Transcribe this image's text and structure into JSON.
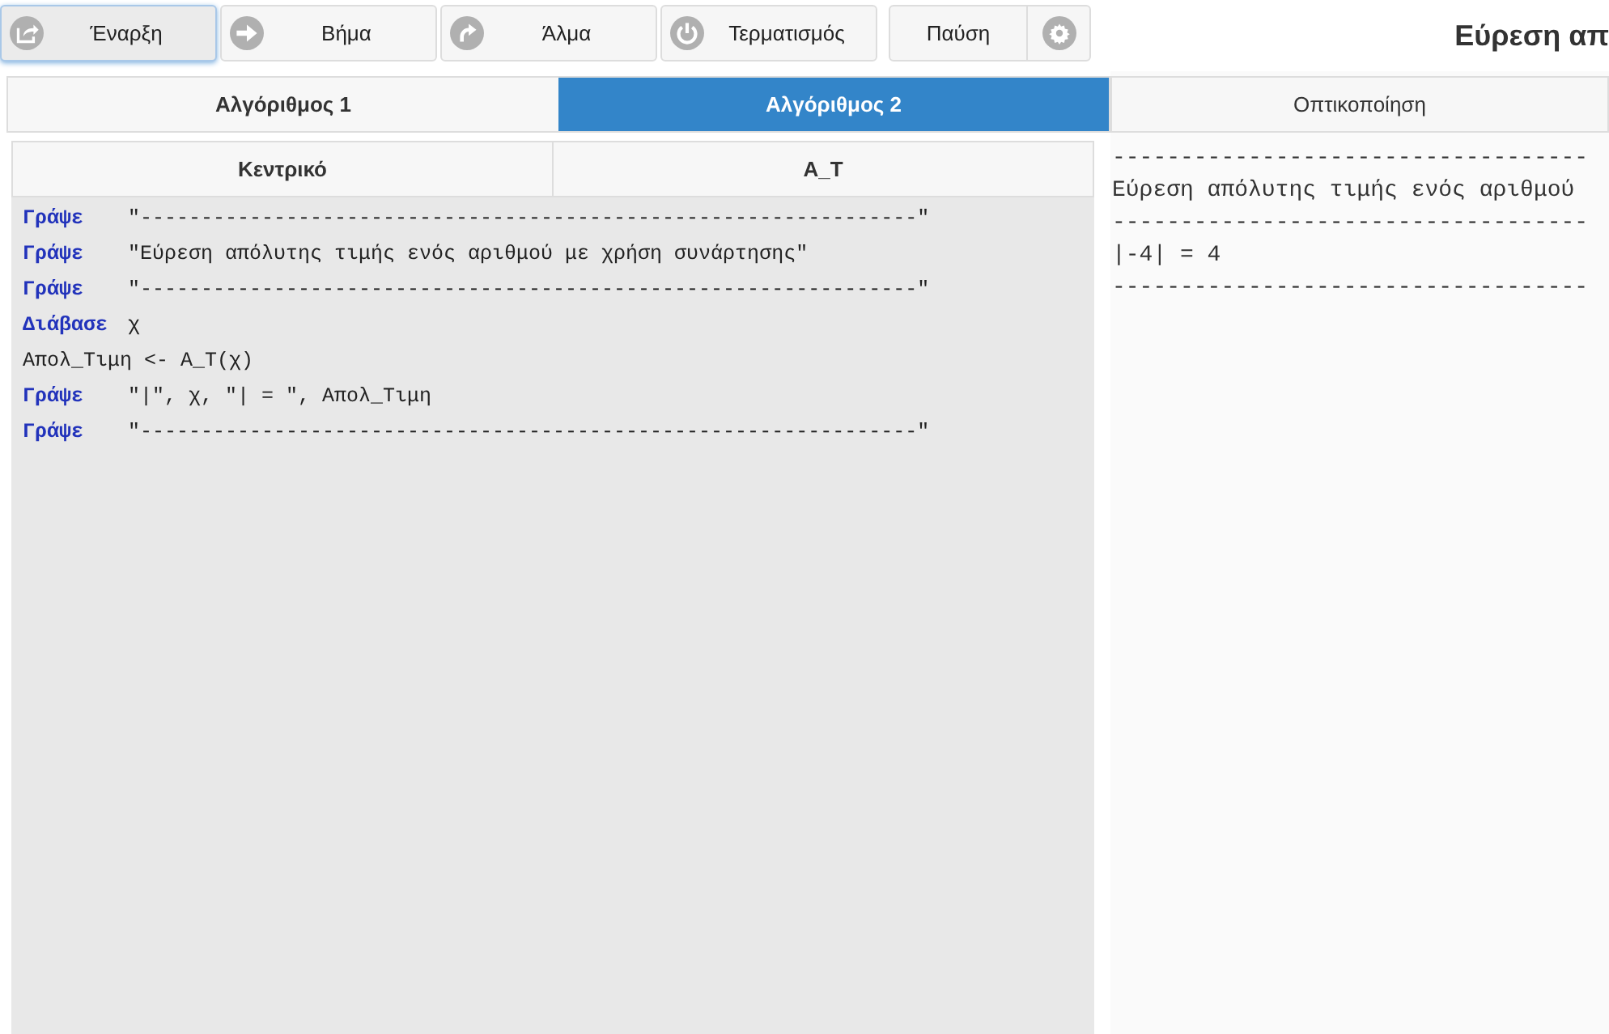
{
  "toolbar": [
    {
      "label": "Έναρξη",
      "selected": true
    },
    {
      "label": "Βήμα",
      "selected": false
    },
    {
      "label": "Άλμα",
      "selected": false
    },
    {
      "label": "Τερματισμός",
      "selected": false
    }
  ],
  "pause_button": {
    "label": "Παύση"
  },
  "page_title": "Εύρεση απ",
  "algorithm_tabs": [
    {
      "label": "Αλγόριθμος 1",
      "selected": false
    },
    {
      "label": "Αλγόριθμος 2",
      "selected": true
    }
  ],
  "visualization_tab": {
    "label": "Οπτικοποίηση"
  },
  "code_tabs": [
    {
      "label": "Κεντρικό"
    },
    {
      "label": "Α_Τ"
    }
  ],
  "code_lines": [
    {
      "keyword": "Γράψε",
      "text": "\"----------------------------------------------------------------\""
    },
    {
      "keyword": "Γράψε",
      "text": "\"Εύρεση απόλυτης τιμής ενός αριθμού με χρήση συνάρτησης\""
    },
    {
      "keyword": "Γράψε",
      "text": "\"----------------------------------------------------------------\""
    },
    {
      "keyword": "Διάβασε",
      "text": "χ"
    },
    {
      "text": "Απολ_Τιμη <- Α_Τ(χ)"
    },
    {
      "keyword": "Γράψε",
      "text": "\"|\", χ, \"| = \", Απολ_Τιμη"
    },
    {
      "keyword": "Γράψε",
      "text": "\"----------------------------------------------------------------\""
    }
  ],
  "output_lines": [
    "-----------------------------------",
    "Εύρεση απόλυτης τιμής ενός αριθμού",
    "-----------------------------------",
    "|-4| = 4",
    "-----------------------------------"
  ]
}
